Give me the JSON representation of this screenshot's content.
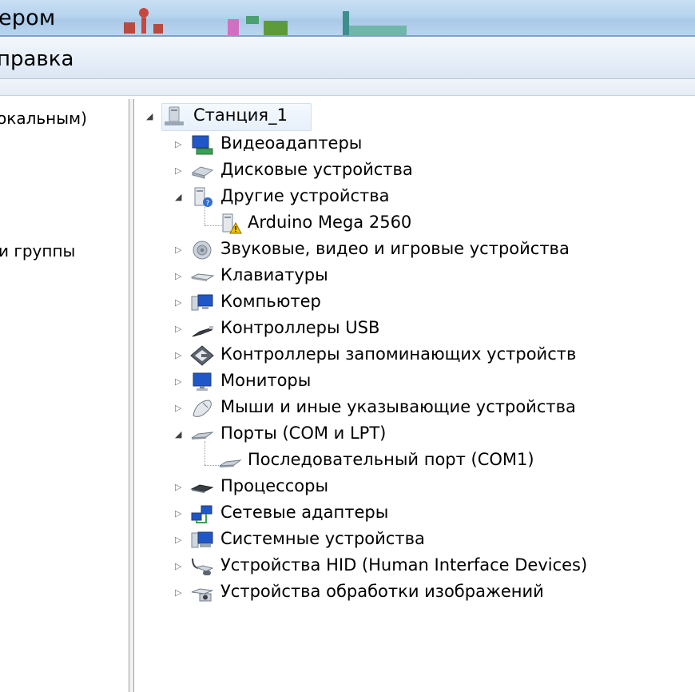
{
  "window": {
    "title_fragment": "ером",
    "menu_fragment": "правка"
  },
  "left_pane": {
    "items": [
      {
        "label": "окальным)"
      },
      {
        "label": "и группы"
      }
    ]
  },
  "tree": {
    "root": {
      "label": "Станция_1",
      "icon": "computer-station-icon",
      "expanded": true
    },
    "nodes": [
      {
        "label": "Видеоадаптеры",
        "icon": "display-adapter-icon",
        "expanded": false
      },
      {
        "label": "Дисковые устройства",
        "icon": "disk-drive-icon",
        "expanded": false
      },
      {
        "label": "Другие устройства",
        "icon": "unknown-device-icon",
        "expanded": true,
        "children": [
          {
            "label": "Arduino Mega 2560",
            "icon": "device-warning-icon"
          }
        ]
      },
      {
        "label": "Звуковые, видео и игровые устройства",
        "icon": "speaker-icon",
        "expanded": false
      },
      {
        "label": "Клавиатуры",
        "icon": "keyboard-icon",
        "expanded": false
      },
      {
        "label": "Компьютер",
        "icon": "computer-icon",
        "expanded": false
      },
      {
        "label": "Контроллеры USB",
        "icon": "usb-icon",
        "expanded": false
      },
      {
        "label": "Контроллеры запоминающих устройств",
        "icon": "storage-controller-icon",
        "expanded": false
      },
      {
        "label": "Мониторы",
        "icon": "monitor-icon",
        "expanded": false
      },
      {
        "label": "Мыши и иные указывающие устройства",
        "icon": "mouse-icon",
        "expanded": false
      },
      {
        "label": "Порты (COM и LPT)",
        "icon": "port-icon",
        "expanded": true,
        "children": [
          {
            "label": "Последовательный порт (COM1)",
            "icon": "serial-port-icon"
          }
        ]
      },
      {
        "label": "Процессоры",
        "icon": "processor-icon",
        "expanded": false
      },
      {
        "label": "Сетевые адаптеры",
        "icon": "network-adapter-icon",
        "expanded": false
      },
      {
        "label": "Системные устройства",
        "icon": "system-device-icon",
        "expanded": false
      },
      {
        "label": "Устройства HID (Human Interface Devices)",
        "icon": "hid-icon",
        "expanded": false
      },
      {
        "label": "Устройства обработки изображений",
        "icon": "imaging-device-icon",
        "expanded": false
      }
    ]
  },
  "colors": {
    "titlebar": "#b6d3ee",
    "menubar": "#e6eef8",
    "selection": "#e7f0fb"
  }
}
